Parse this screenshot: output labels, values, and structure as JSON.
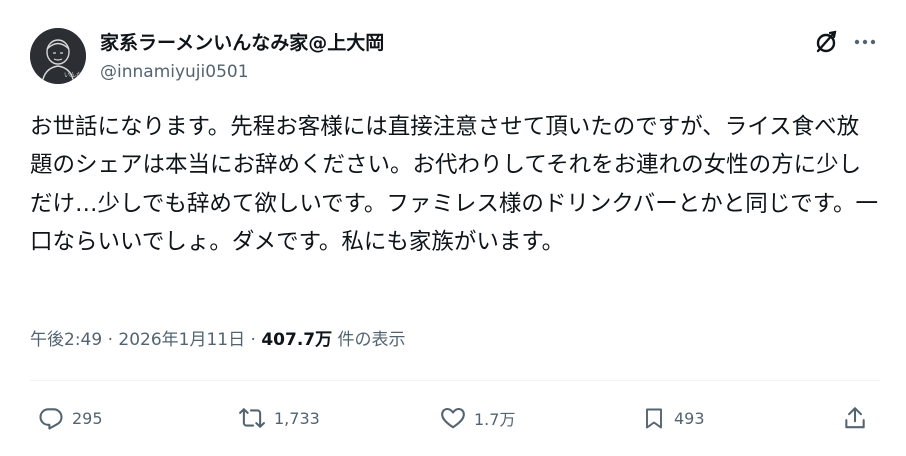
{
  "author": {
    "display_name": "家系ラーメンいんなみ家@上大岡",
    "handle": "@innamiyuji0501",
    "avatar_text": "いんなみ家"
  },
  "tweet": {
    "text": "お世話になります。先程お客様には直接注意させて頂いたのですが、ライス食べ放題のシェアは本当にお辞めください。お代わりしてそれをお連れの女性の方に少しだけ…少しでも辞めて欲しいです。ファミレス様のドリンクバーとかと同じです。一口ならいいでしょ。ダメです。私にも家族がいます。"
  },
  "meta": {
    "time": "午後2:49",
    "separator": "·",
    "date": "2026年1月11日",
    "views_count": "407.7万",
    "views_label": "件の表示"
  },
  "actions": {
    "reply_count": "295",
    "retweet_count": "1,733",
    "like_count": "1.7万",
    "bookmark_count": "493"
  },
  "icons": {
    "grok": "grok-icon",
    "more": "more-icon",
    "reply": "reply-icon",
    "retweet": "retweet-icon",
    "like": "heart-icon",
    "bookmark": "bookmark-icon",
    "share": "share-icon"
  },
  "colors": {
    "text": "#0f1419",
    "secondary": "#536471",
    "divider": "#eff3f4"
  }
}
